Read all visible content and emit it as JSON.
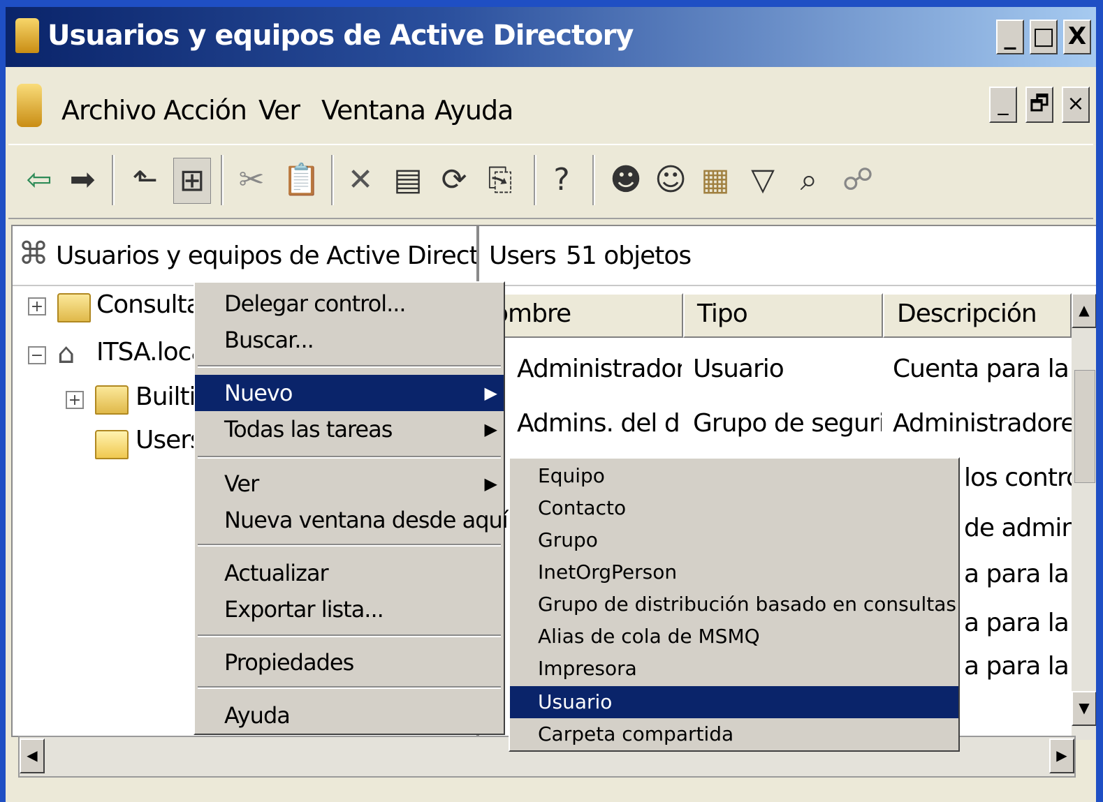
{
  "window": {
    "title": "Usuarios y equipos de Active Directory",
    "controls": {
      "minimize": "_",
      "maximize": "□",
      "close": "X"
    }
  },
  "menubar": {
    "items": [
      "Archivo",
      "Acción",
      "Ver",
      "Ventana",
      "Ayuda"
    ],
    "child_controls": {
      "minimize": "_",
      "restore": "🗗",
      "close": "×"
    }
  },
  "toolbar": {
    "buttons": [
      "back-icon",
      "forward-icon",
      "up-icon",
      "show-hide-tree-icon",
      "cut-icon",
      "paste-icon",
      "delete-icon",
      "properties-icon",
      "refresh-icon",
      "export-icon",
      "help-icon",
      "new-user-icon",
      "new-group-icon",
      "new-ou-icon",
      "filter-icon",
      "find-icon",
      "add-member-icon"
    ]
  },
  "tree": {
    "root_label": "Usuarios y equipos de Active Directory [se",
    "nodes": [
      {
        "label": "Consultas",
        "expander": "+"
      },
      {
        "label": "ITSA.local",
        "expander": "−"
      },
      {
        "label": "Builtin",
        "expander": "+"
      },
      {
        "label": "Users",
        "expander": ""
      }
    ]
  },
  "right_pane": {
    "container": "Users",
    "count": "51 objetos",
    "columns": [
      "ombre",
      "Tipo",
      "Descripción"
    ],
    "rows": [
      {
        "name": "Administrador",
        "type": "Usuario",
        "desc": "Cuenta para la ac"
      },
      {
        "name": "Admins. del d...",
        "type": "Grupo de seguri...",
        "desc": "Administradores c"
      }
    ],
    "partial_desc": [
      "los controla",
      "de administ",
      "a para la ac",
      "a para la ac",
      "a para la ac"
    ]
  },
  "context_menu": {
    "items": [
      {
        "label": "Delegar control...",
        "arrow": ""
      },
      {
        "label": "Buscar...",
        "arrow": ""
      },
      {
        "label": "Nuevo",
        "arrow": "▶"
      },
      {
        "label": "Todas las tareas",
        "arrow": "▶"
      },
      {
        "label": "Ver",
        "arrow": "▶"
      },
      {
        "label": "Nueva ventana desde aquí",
        "arrow": ""
      },
      {
        "label": "Actualizar",
        "arrow": ""
      },
      {
        "label": "Exportar lista...",
        "arrow": ""
      },
      {
        "label": "Propiedades",
        "arrow": ""
      },
      {
        "label": "Ayuda",
        "arrow": ""
      }
    ],
    "selected": "Nuevo"
  },
  "submenu": {
    "items": [
      "Equipo",
      "Contacto",
      "Grupo",
      "InetOrgPerson",
      "Grupo de distribución basado en consultas",
      "Alias de cola de MSMQ",
      "Impresora",
      "Usuario",
      "Carpeta compartida"
    ],
    "selected": "Usuario"
  },
  "colors": {
    "selection": "#0a246a",
    "menu_bg": "#d4d0c8",
    "window_bg": "#ece9d8",
    "desktop": "#1f4fc4"
  }
}
